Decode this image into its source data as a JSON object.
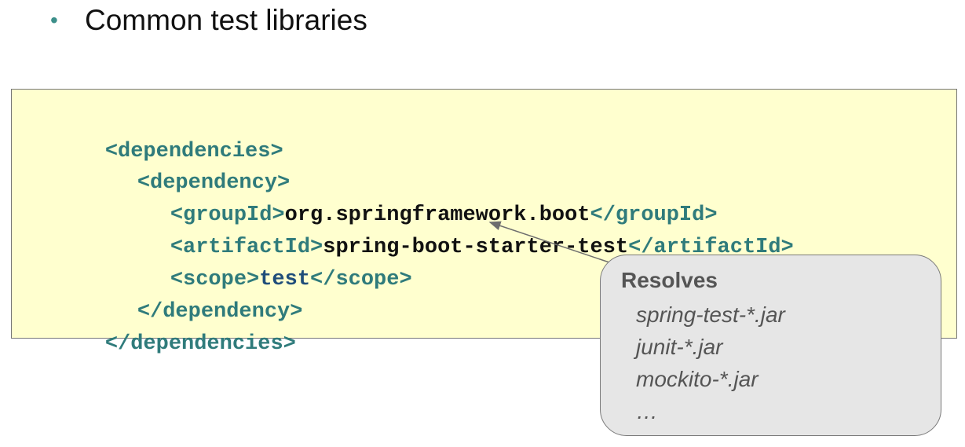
{
  "heading": {
    "bullet": "•",
    "text": "Common test libraries"
  },
  "code": {
    "lines": [
      {
        "open": "<dependencies>"
      },
      {
        "open": "<dependency>"
      },
      {
        "open": "<groupId>",
        "value": "org.springframework.boot",
        "close": "</groupId>"
      },
      {
        "open": "<artifactId>",
        "value": "spring-boot-starter-test",
        "close": "</artifactId>"
      },
      {
        "open": "<scope>",
        "value": "test",
        "close": "</scope>"
      },
      {
        "open": "</dependency>"
      },
      {
        "open": "</dependencies>"
      }
    ]
  },
  "callout": {
    "title": "Resolves",
    "items": [
      "spring-test-*.jar",
      "junit-*.jar",
      "mockito-*.jar",
      "…"
    ]
  },
  "colors": {
    "tag": "#2f7b7b",
    "code_background": "#ffffcf",
    "callout_background": "#e6e6e6",
    "bullet": "#3c8f8a"
  }
}
